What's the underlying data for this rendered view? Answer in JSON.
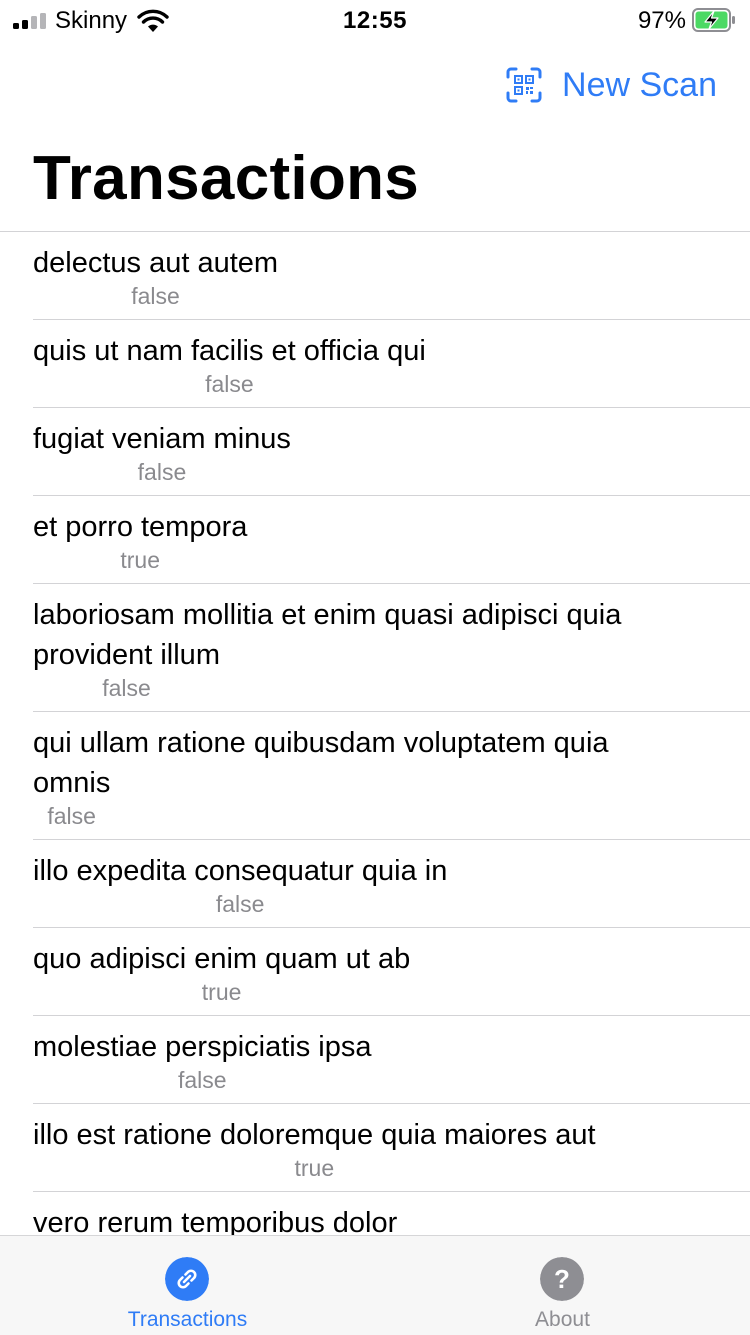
{
  "status_bar": {
    "carrier": "Skinny",
    "time": "12:55",
    "battery_percent": "97%"
  },
  "nav": {
    "action_label": "New Scan",
    "action_icon": "qr-code-scan-icon",
    "accent_color": "#2f7cf6"
  },
  "title": "Transactions",
  "transactions": [
    {
      "title": "delectus aut autem",
      "status": "false"
    },
    {
      "title": "quis ut nam facilis et officia qui",
      "status": "false"
    },
    {
      "title": "fugiat veniam minus",
      "status": "false"
    },
    {
      "title": "et porro tempora",
      "status": "true"
    },
    {
      "title": "laboriosam mollitia et enim quasi adipisci quia provident illum",
      "status": "false"
    },
    {
      "title": "qui ullam ratione quibusdam voluptatem quia omnis",
      "status": "false"
    },
    {
      "title": "illo expedita consequatur quia in",
      "status": "false"
    },
    {
      "title": "quo adipisci enim quam ut ab",
      "status": "true"
    },
    {
      "title": "molestiae perspiciatis ipsa",
      "status": "false"
    },
    {
      "title": "illo est ratione doloremque quia maiores aut",
      "status": "true"
    },
    {
      "title": "vero rerum temporibus dolor",
      "status": ""
    }
  ],
  "tab_bar": {
    "tabs": [
      {
        "label": "Transactions",
        "icon": "link-icon",
        "active": true,
        "color": "#2f7cf6"
      },
      {
        "label": "About",
        "icon": "question-mark-icon",
        "active": false,
        "color": "#8e8e93"
      }
    ]
  }
}
